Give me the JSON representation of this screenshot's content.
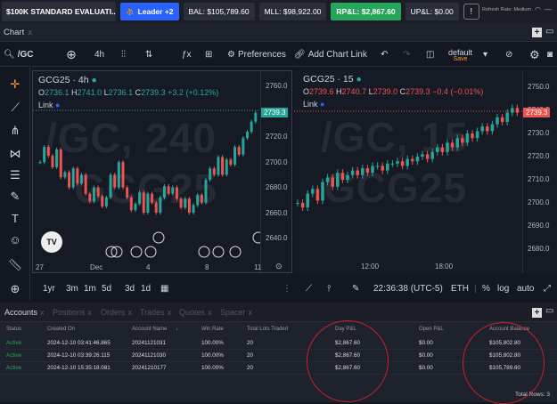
{
  "topbar": {
    "account": "$100K STANDARD EVALUATI...",
    "leader": "Leader +2",
    "bal": "BAL: $105,789.60",
    "mll": "MLL: $98,922.00",
    "rpl": "RP&L: $2,867.60",
    "upl": "UP&L: $0.00",
    "refresh": "Refresh Rate: Medium"
  },
  "tabs": {
    "chart": "Chart",
    "close": "x"
  },
  "toolbar": {
    "symbol": "/GC",
    "interval": "4h",
    "preferences": "Preferences",
    "add_chart_link": "Add Chart Link",
    "layout": "default",
    "save": "Save"
  },
  "left_chart": {
    "title": "GCG25 · 4h",
    "o": "2736.1",
    "h": "2741.0",
    "l": "2736.1",
    "c": "2739.3",
    "chg": "+3.2 (+0.12%)",
    "link": "Link",
    "wm1": "/GC, 240",
    "wm2": "GCG25",
    "price": "2739.3",
    "ticks": [
      "2760.0",
      "2740.0",
      "2720.0",
      "2700.0",
      "2680.0",
      "2660.0",
      "2640.0"
    ],
    "times": [
      "27",
      "Dec",
      "4",
      "8",
      "11"
    ]
  },
  "right_chart": {
    "title": "GCG25 · 15",
    "o": "2739.6",
    "h": "2740.7",
    "l": "2739.0",
    "c": "2739.3",
    "chg": "−0.4 (−0.01%)",
    "link": "Link",
    "wm1": "/GC, 15",
    "wm2": "GCG25",
    "price": "2739.3",
    "ticks": [
      "2750.0",
      "2740.0",
      "2730.0",
      "2720.0",
      "2710.0",
      "2700.0",
      "2690.0",
      "2680.0"
    ],
    "times": [
      "12:00",
      "18:00"
    ]
  },
  "bottom_toolbar": {
    "ranges": [
      "1yr",
      "3m",
      "1m",
      "5d",
      "3d",
      "1d"
    ],
    "clock": "22:36:38 (UTC-5)",
    "session": "ETH",
    "pct": "%",
    "log": "log",
    "auto": "auto"
  },
  "panel": {
    "tabs": [
      "Accounts",
      "Positions",
      "Orders",
      "Trades",
      "Quotes",
      "Spacer"
    ],
    "headers": [
      "Status",
      "Created On",
      "Account Name",
      "Win Rate",
      "Total Lots Traded",
      "Day P&L",
      "Open P&L",
      "Account Balance"
    ],
    "rows": [
      [
        "Active",
        "2024-12-10 03:41:46.865",
        "20241121031",
        "100.00%",
        "20",
        "$2,867.60",
        "$0.00",
        "$105,802.80"
      ],
      [
        "Active",
        "2024-12-10 03:39:26.115",
        "20241121030",
        "100.00%",
        "20",
        "$2,867.60",
        "$0.00",
        "$105,802.80"
      ],
      [
        "Active",
        "2024-12-10 15:35:18.081",
        "20241210177",
        "100.00%",
        "20",
        "$2,867.60",
        "$0.00",
        "$105,789.60"
      ]
    ],
    "total_rows": "Total Rows: 3"
  },
  "colors": {
    "up": "#26a69a",
    "down": "#ef5350",
    "accent": "#2962ff",
    "active": "#26a65b",
    "circle": "#d0202a"
  }
}
